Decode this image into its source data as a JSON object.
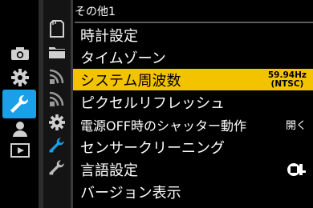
{
  "header": {
    "title": "その他1"
  },
  "categories": [
    {
      "icon": "camera-icon"
    },
    {
      "icon": "gear-icon"
    },
    {
      "icon": "wrench-icon",
      "selected": true
    },
    {
      "icon": "person-icon"
    },
    {
      "icon": "playback-icon"
    }
  ],
  "subtabs": [
    {
      "icon": "card-icon"
    },
    {
      "icon": "folder-icon"
    },
    {
      "icon": "wireless-icon"
    },
    {
      "icon": "wireless-bluetooth-icon"
    },
    {
      "icon": "gear-icon"
    },
    {
      "icon": "wrench-1-icon",
      "selected": true
    },
    {
      "icon": "wrench-2-icon"
    }
  ],
  "menu": {
    "items": [
      {
        "label": "時計設定"
      },
      {
        "label": "タイムゾーン"
      },
      {
        "label": "システム周波数",
        "value_line1": "59.94Hz",
        "value_line2": "(NTSC)",
        "selected": true
      },
      {
        "label": "ピクセルリフレッシュ"
      },
      {
        "label": "電源OFF時のシャッター動作",
        "value": "開く"
      },
      {
        "label": "センサークリーニング"
      },
      {
        "label": "言語設定",
        "value_icon": "language-icon"
      },
      {
        "label": "バージョン表示"
      }
    ]
  },
  "colors": {
    "accent_blue": "#1aa0e8",
    "highlight_yellow": "#f4c300",
    "text": "#ffffff",
    "background": "#000000"
  }
}
